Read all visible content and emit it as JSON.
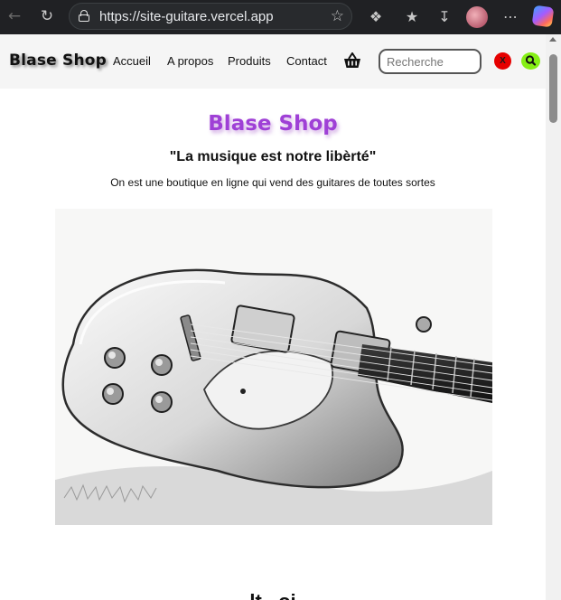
{
  "browser": {
    "url": "https://site-guitare.vercel.app",
    "icons": [
      "back-icon",
      "reload-icon",
      "lock-icon",
      "star-icon",
      "extensions-icon",
      "favorites-icon",
      "download-icon",
      "profile-avatar",
      "more-icon",
      "copilot-icon"
    ]
  },
  "site": {
    "brand": "Blase Shop",
    "nav": [
      "Accueil",
      "A propos",
      "Produits",
      "Contact"
    ],
    "basket_icon": "basket-icon",
    "search": {
      "placeholder": "Recherche",
      "value": ""
    },
    "clear_label": "X",
    "search_icon": "search-icon"
  },
  "hero": {
    "title": "Blase Shop",
    "tagline": "\"La musique est notre libèrté\"",
    "description": "On est une boutique en ligne qui vend des guitares de toutes sortes",
    "image": "electric-guitar-sketch",
    "next_heading": "lt...oi"
  },
  "colors": {
    "title": "#9f40d6",
    "clear_button": "#e60000",
    "search_button": "#86ef16",
    "navbar_bg": "#f5f5f5"
  }
}
